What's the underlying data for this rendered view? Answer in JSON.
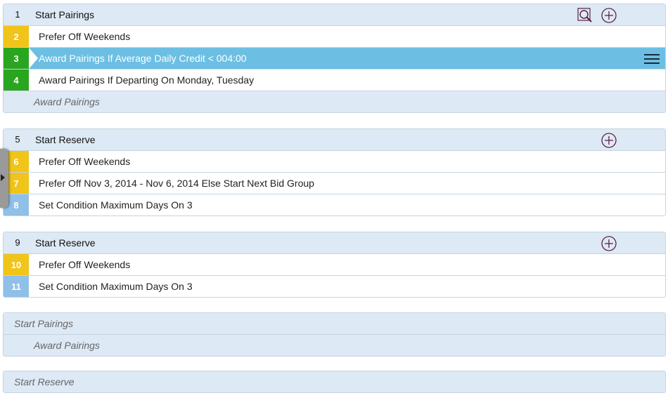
{
  "groups": [
    {
      "header": {
        "num": "1",
        "label": "Start Pairings"
      },
      "rules": [
        {
          "num": "2",
          "label": "Prefer Off Weekends",
          "color": "yellow"
        },
        {
          "num": "3",
          "label": "Award Pairings If Average Daily Credit < 004:00",
          "color": "green",
          "selected": true
        },
        {
          "num": "4",
          "label": "Award Pairings If Departing On Monday, Tuesday",
          "color": "green"
        }
      ],
      "placeholder": "Award Pairings"
    },
    {
      "header": {
        "num": "5",
        "label": "Start Reserve"
      },
      "rules": [
        {
          "num": "6",
          "label": "Prefer Off Weekends",
          "color": "yellow"
        },
        {
          "num": "7",
          "label": "Prefer Off Nov 3, 2014 - Nov 6, 2014 Else Start Next Bid Group",
          "color": "yellow"
        },
        {
          "num": "8",
          "label": "Set Condition Maximum Days On 3",
          "color": "blue"
        }
      ]
    },
    {
      "header": {
        "num": "9",
        "label": "Start Reserve"
      },
      "rules": [
        {
          "num": "10",
          "label": "Prefer Off Weekends",
          "color": "yellow"
        },
        {
          "num": "11",
          "label": "Set Condition Maximum Days On 3",
          "color": "blue"
        }
      ]
    }
  ],
  "placeholder_group_1": {
    "start": "Start Pairings",
    "award": "Award Pairings"
  },
  "placeholder_group_2": {
    "start": "Start Reserve"
  },
  "colors": {
    "yellow": "#f0c419",
    "green": "#2aa520",
    "blue": "#8fc0e8",
    "selected_row": "#6cbfe3",
    "header_bg": "#dde9f4"
  },
  "icons": {
    "search": "search-icon",
    "add": "plus-circle-icon",
    "menu": "hamburger-menu-icon",
    "handle": "side-panel-handle"
  }
}
